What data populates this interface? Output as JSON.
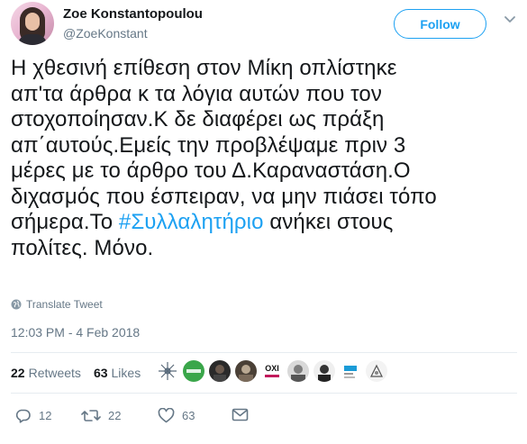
{
  "user": {
    "name": "Zoe Konstantopoulou",
    "handle": "@ZoeKonstant"
  },
  "header": {
    "follow_label": "Follow"
  },
  "tweet": {
    "lines": [
      "Η χθεσινή επίθεση στον Μίκη οπλίστηκε",
      "απ'τα άρθρα κ τα λόγια αυτών που τον",
      "στοχοποίησαν.Κ δε διαφέρει ως πράξη",
      "απ΄αυτούς.Εμείς την προβλέψαμε πριν 3",
      "μέρες με το άρθρο του Δ.Καραναστάση.Ο",
      "διχασμός που έσπειραν, να μην πιάσει τόπο"
    ],
    "line7_prefix": "σήμερα.Το ",
    "hashtag": "#Συλλαλητήριο",
    "line7_suffix": " ανήκει στους",
    "line8": "πολίτες. Μόνο."
  },
  "translate_label": "Translate Tweet",
  "timestamp": "12:03 PM - 4 Feb 2018",
  "stats": {
    "retweets_count": "22",
    "retweets_label": "Retweets",
    "likes_count": "63",
    "likes_label": "Likes"
  },
  "likers": {
    "labels": [
      "OXI"
    ]
  },
  "actions": {
    "replies": "12",
    "retweets": "22",
    "likes": "63"
  },
  "colors": {
    "accent": "#1da1f2",
    "secondary_text": "#657786",
    "primary_text": "#14171a",
    "divider": "#e6ecf0",
    "like_heart": "#e0245e"
  }
}
